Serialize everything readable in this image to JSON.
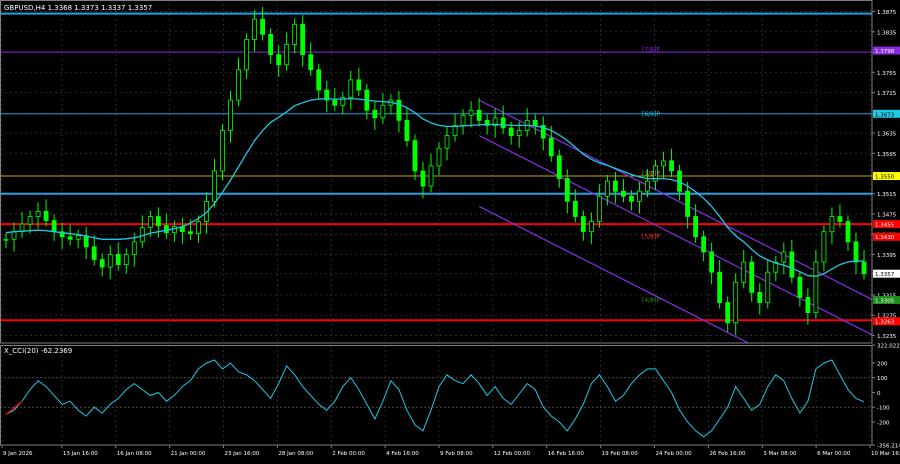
{
  "header": {
    "symbol_info": "GBPUSD,H4  1.3368  1.3373  1.3337  1.3357"
  },
  "indicator": {
    "label": "X_CCI(20) -62.2369"
  },
  "colors": {
    "background": "#000000",
    "grid": "#3a3a3a",
    "candles": "#00ff00",
    "moving_average": "#1ec8e6",
    "regression_channel": "#8a2be2",
    "resistance_support": "#ff0000",
    "murrey_blue": "#1ea0e6",
    "cci_line": "#1ec8e6",
    "current_price_label": "#ffffff"
  },
  "chart_data": {
    "type": "line",
    "title": "GBPUSD,H4",
    "ylim": [
      1.322,
      1.389
    ],
    "y_ticks": [
      "1.3875",
      "1.3835",
      "1.3795",
      "1.3755",
      "1.3715",
      "1.3673",
      "1.3635",
      "1.3595",
      "1.3550",
      "1.3515",
      "1.3475",
      "1.3435",
      "1.3395",
      "1.3357",
      "1.3315",
      "1.3275",
      "1.3235"
    ],
    "x_ticks": [
      "9 Jan 2026",
      "13 Jan 16:00",
      "16 Jan 08:00",
      "21 Jan 00:00",
      "23 Jan 16:00",
      "28 Jan 08:00",
      "2 Feb 00:00",
      "4 Feb 16:00",
      "9 Feb 08:00",
      "12 Feb 00:00",
      "16 Feb 16:00",
      "19 Feb 08:00",
      "24 Feb 00:00",
      "26 Feb 16:00",
      "3 Mar 08:00",
      "6 Mar 00:00",
      "10 Mar 16:00"
    ],
    "price_series": [
      1.3425,
      1.344,
      1.3455,
      1.347,
      1.348,
      1.3462,
      1.344,
      1.343,
      1.3425,
      1.3432,
      1.341,
      1.3385,
      1.337,
      1.3395,
      1.3375,
      1.3395,
      1.342,
      1.3448,
      1.347,
      1.3452,
      1.3438,
      1.345,
      1.344,
      1.3436,
      1.346,
      1.35,
      1.356,
      1.364,
      1.37,
      1.376,
      1.382,
      1.386,
      1.383,
      1.379,
      1.377,
      1.381,
      1.385,
      1.379,
      1.376,
      1.372,
      1.37,
      1.369,
      1.3705,
      1.374,
      1.372,
      1.368,
      1.3665,
      1.369,
      1.37,
      1.366,
      1.362,
      1.356,
      1.353,
      1.357,
      1.3605,
      1.363,
      1.365,
      1.367,
      1.368,
      1.366,
      1.365,
      1.3665,
      1.3645,
      1.363,
      1.364,
      1.366,
      1.365,
      1.3625,
      1.359,
      1.3545,
      1.35,
      1.347,
      1.344,
      1.346,
      1.351,
      1.354,
      1.352,
      1.351,
      1.35,
      1.352,
      1.354,
      1.357,
      1.358,
      1.356,
      1.352,
      1.347,
      1.343,
      1.34,
      1.336,
      1.33,
      1.326,
      1.334,
      1.338,
      1.332,
      1.33,
      1.336,
      1.338,
      1.34,
      1.335,
      1.331,
      1.328,
      1.338,
      1.344,
      1.347,
      1.346,
      1.342,
      1.338,
      1.3357
    ],
    "ma_series": [
      1.3438,
      1.344,
      1.3441,
      1.3442,
      1.3443,
      1.3442,
      1.344,
      1.3438,
      1.3436,
      1.3434,
      1.3431,
      1.3428,
      1.3425,
      1.3425,
      1.3425,
      1.3426,
      1.3428,
      1.3432,
      1.3437,
      1.344,
      1.3443,
      1.3446,
      1.345,
      1.3457,
      1.3466,
      1.3478,
      1.3496,
      1.3518,
      1.3542,
      1.3568,
      1.3595,
      1.362,
      1.364,
      1.3656,
      1.3666,
      1.3677,
      1.3689,
      1.3695,
      1.37,
      1.3702,
      1.3703,
      1.3702,
      1.3702,
      1.3703,
      1.3702,
      1.37,
      1.3698,
      1.3697,
      1.3696,
      1.3692,
      1.3685,
      1.3675,
      1.3663,
      1.3655,
      1.365,
      1.3648,
      1.3648,
      1.3649,
      1.365,
      1.3651,
      1.3652,
      1.3652,
      1.3651,
      1.365,
      1.365,
      1.365,
      1.3649,
      1.3646,
      1.364,
      1.3631,
      1.362,
      1.3607,
      1.3593,
      1.3583,
      1.3576,
      1.3571,
      1.3565,
      1.3559,
      1.3553,
      1.3548,
      1.3545,
      1.3545,
      1.3545,
      1.3543,
      1.3538,
      1.353,
      1.3519,
      1.3506,
      1.349,
      1.347,
      1.3448,
      1.3432,
      1.342,
      1.3405,
      1.3392,
      1.3384,
      1.3378,
      1.3374,
      1.3368,
      1.3361,
      1.3353,
      1.3352,
      1.3357,
      1.3366,
      1.3375,
      1.338,
      1.3382,
      1.3382
    ],
    "horizontal_levels": [
      {
        "price": 1.3871,
        "color": "#1ea0e6",
        "width": 2
      },
      {
        "price": 1.3795,
        "color": "#8a2be2",
        "width": 1
      },
      {
        "price": 1.3673,
        "color": "#1ea0e6",
        "width": 1
      },
      {
        "price": 1.355,
        "color": "#c8a800",
        "width": 1
      },
      {
        "price": 1.3515,
        "color": "#1ea0e6",
        "width": 2
      },
      {
        "price": 1.3455,
        "color": "#ff0000",
        "width": 2
      },
      {
        "price": 1.3265,
        "color": "#ff0000",
        "width": 2
      }
    ],
    "level_labels": [
      {
        "text": "[7/8]P",
        "price": 1.38,
        "color": "#8a2be2"
      },
      {
        "text": "[6/8]P",
        "price": 1.3673,
        "color": "#1ec8e6"
      },
      {
        "text": "[7/8]P",
        "price": 1.3555,
        "color": "#c8a800"
      },
      {
        "text": "[5/8]P",
        "price": 1.343,
        "color": "#ff3030"
      },
      {
        "text": "[4/8]P",
        "price": 1.3305,
        "color": "#1e8c1e"
      }
    ],
    "price_tags": [
      {
        "text": "1.3798",
        "price": 1.3798,
        "bg": "#8a2be2",
        "fg": "#ffffff"
      },
      {
        "text": "1.3673",
        "price": 1.3673,
        "bg": "#1ec8e6",
        "fg": "#000000"
      },
      {
        "text": "1.3550",
        "price": 1.355,
        "bg": "#ffff00",
        "fg": "#000000"
      },
      {
        "text": "1.3455",
        "price": 1.3455,
        "bg": "#ff0000",
        "fg": "#ffffff"
      },
      {
        "text": "1.3430",
        "price": 1.343,
        "bg": "#ff0000",
        "fg": "#ffffff"
      },
      {
        "text": "1.3357",
        "price": 1.3357,
        "bg": "#ffffff",
        "fg": "#000000"
      },
      {
        "text": "1.3305",
        "price": 1.3305,
        "bg": "#1e8c1e",
        "fg": "#ffffff"
      },
      {
        "text": "1.3263",
        "price": 1.3263,
        "bg": "#ff0000",
        "fg": "#ffffff"
      }
    ],
    "channel_lines": [
      {
        "from_index": 59,
        "from_price": 1.37,
        "to_index": 110,
        "to_price": 1.329
      },
      {
        "from_index": 59,
        "from_price": 1.363,
        "to_index": 110,
        "to_price": 1.322
      },
      {
        "from_index": 59,
        "from_price": 1.349,
        "to_index": 110,
        "to_price": 1.308
      }
    ],
    "cci": {
      "ylim": [
        -356.2143,
        322.0224
      ],
      "y_ticks": [
        "322.0224",
        "200",
        "100",
        "0",
        "-100",
        "-200",
        "-356.2143"
      ],
      "values": [
        -150,
        -120,
        -60,
        20,
        80,
        40,
        -20,
        -80,
        -60,
        -120,
        -160,
        -100,
        -140,
        -80,
        -40,
        20,
        60,
        20,
        -20,
        0,
        -60,
        -20,
        40,
        80,
        160,
        200,
        220,
        160,
        200,
        140,
        120,
        80,
        20,
        -40,
        60,
        180,
        120,
        40,
        -20,
        -80,
        -120,
        -60,
        40,
        100,
        20,
        -80,
        -180,
        -60,
        80,
        20,
        -120,
        -220,
        -260,
        -120,
        40,
        120,
        80,
        60,
        120,
        60,
        -20,
        40,
        -40,
        -80,
        -10,
        60,
        20,
        -100,
        -160,
        -200,
        -260,
        -180,
        -80,
        60,
        120,
        40,
        -60,
        -20,
        60,
        120,
        160,
        160,
        80,
        0,
        -120,
        -200,
        -260,
        -300,
        -260,
        -180,
        -100,
        40,
        -40,
        -120,
        -80,
        40,
        120,
        80,
        -40,
        -140,
        -60,
        160,
        200,
        220,
        120,
        20,
        -40,
        -62.2369
      ]
    }
  }
}
